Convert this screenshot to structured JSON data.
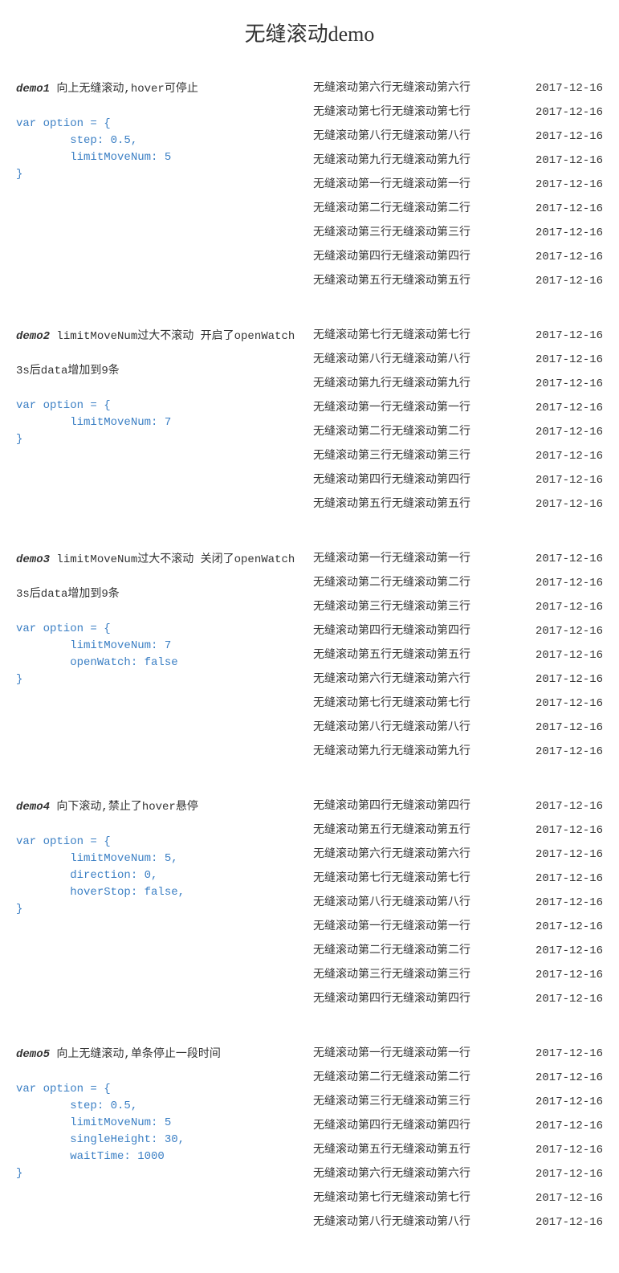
{
  "page_title": "无缝滚动demo",
  "date": "2017-12-16",
  "demos": [
    {
      "label": "demo1",
      "title": " 向上无缝滚动,hover可停止",
      "note": "",
      "code": "var option = {\n        step: 0.5,\n        limitMoveNum: 5\n}",
      "rows": [
        "无缝滚动第六行无缝滚动第六行",
        "无缝滚动第七行无缝滚动第七行",
        "无缝滚动第八行无缝滚动第八行",
        "无缝滚动第九行无缝滚动第九行",
        "无缝滚动第一行无缝滚动第一行",
        "无缝滚动第二行无缝滚动第二行",
        "无缝滚动第三行无缝滚动第三行",
        "无缝滚动第四行无缝滚动第四行",
        "无缝滚动第五行无缝滚动第五行"
      ]
    },
    {
      "label": "demo2",
      "title": " limitMoveNum过大不滚动 开启了openWatch",
      "note": "3s后data增加到9条",
      "code": "var option = {\n        limitMoveNum: 7\n}",
      "rows": [
        "无缝滚动第七行无缝滚动第七行",
        "无缝滚动第八行无缝滚动第八行",
        "无缝滚动第九行无缝滚动第九行",
        "无缝滚动第一行无缝滚动第一行",
        "无缝滚动第二行无缝滚动第二行",
        "无缝滚动第三行无缝滚动第三行",
        "无缝滚动第四行无缝滚动第四行",
        "无缝滚动第五行无缝滚动第五行"
      ]
    },
    {
      "label": "demo3",
      "title": " limitMoveNum过大不滚动 关闭了openWatch",
      "note": "3s后data增加到9条",
      "code": "var option = {\n        limitMoveNum: 7\n        openWatch: false\n}",
      "rows": [
        "无缝滚动第一行无缝滚动第一行",
        "无缝滚动第二行无缝滚动第二行",
        "无缝滚动第三行无缝滚动第三行",
        "无缝滚动第四行无缝滚动第四行",
        "无缝滚动第五行无缝滚动第五行",
        "无缝滚动第六行无缝滚动第六行",
        "无缝滚动第七行无缝滚动第七行",
        "无缝滚动第八行无缝滚动第八行",
        "无缝滚动第九行无缝滚动第九行"
      ]
    },
    {
      "label": "demo4",
      "title": " 向下滚动,禁止了hover悬停",
      "note": "",
      "code": "var option = {\n        limitMoveNum: 5,\n        direction: 0,\n        hoverStop: false,\n}",
      "rows": [
        "无缝滚动第四行无缝滚动第四行",
        "无缝滚动第五行无缝滚动第五行",
        "无缝滚动第六行无缝滚动第六行",
        "无缝滚动第七行无缝滚动第七行",
        "无缝滚动第八行无缝滚动第八行",
        "无缝滚动第一行无缝滚动第一行",
        "无缝滚动第二行无缝滚动第二行",
        "无缝滚动第三行无缝滚动第三行",
        "无缝滚动第四行无缝滚动第四行"
      ]
    },
    {
      "label": "demo5",
      "title": " 向上无缝滚动,单条停止一段时间",
      "note": "",
      "code": "var option = {\n        step: 0.5,\n        limitMoveNum: 5\n        singleHeight: 30,\n        waitTime: 1000\n}",
      "rows": [
        "无缝滚动第一行无缝滚动第一行",
        "无缝滚动第二行无缝滚动第二行",
        "无缝滚动第三行无缝滚动第三行",
        "无缝滚动第四行无缝滚动第四行",
        "无缝滚动第五行无缝滚动第五行",
        "无缝滚动第六行无缝滚动第六行",
        "无缝滚动第七行无缝滚动第七行",
        "无缝滚动第八行无缝滚动第八行"
      ]
    }
  ]
}
